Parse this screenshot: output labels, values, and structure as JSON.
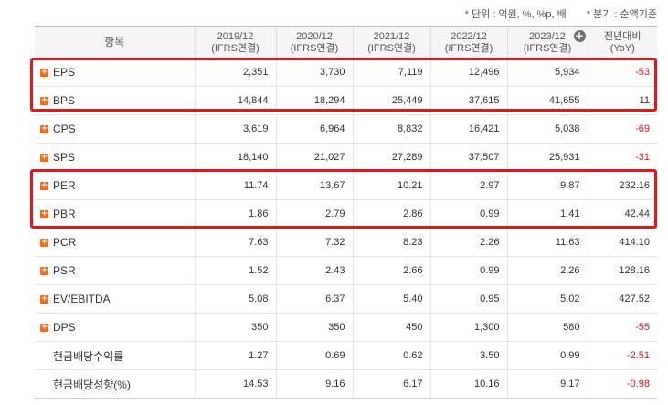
{
  "units_note": "* 단위 : 억원, %, %p, 배",
  "period_note": "* 분기 : 순액기준",
  "header": {
    "item": "항목",
    "cols": [
      {
        "line1": "2019/12",
        "line2": "(IFRS연결)"
      },
      {
        "line1": "2020/12",
        "line2": "(IFRS연결)"
      },
      {
        "line1": "2021/12",
        "line2": "(IFRS연결)"
      },
      {
        "line1": "2022/12",
        "line2": "(IFRS연결)"
      },
      {
        "line1": "2023/12",
        "line2": "(IFRS연결)"
      }
    ],
    "yoy_line1": "전년대비",
    "yoy_line2": "(YoY)"
  },
  "rows": [
    {
      "label": "EPS",
      "values": [
        "2,351",
        "3,730",
        "7,119",
        "12,496",
        "5,934"
      ],
      "yoy": "-53"
    },
    {
      "label": "BPS",
      "values": [
        "14,844",
        "18,294",
        "25,449",
        "37,615",
        "41,655"
      ],
      "yoy": "11"
    },
    {
      "label": "CPS",
      "values": [
        "3,619",
        "6,964",
        "8,832",
        "16,421",
        "5,038"
      ],
      "yoy": "-69"
    },
    {
      "label": "SPS",
      "values": [
        "18,140",
        "21,027",
        "27,289",
        "37,507",
        "25,931"
      ],
      "yoy": "-31"
    },
    {
      "label": "PER",
      "values": [
        "11.74",
        "13.67",
        "10.21",
        "2.97",
        "9.87"
      ],
      "yoy": "232.16"
    },
    {
      "label": "PBR",
      "values": [
        "1.86",
        "2.79",
        "2.86",
        "0.99",
        "1.41"
      ],
      "yoy": "42.44"
    },
    {
      "label": "PCR",
      "values": [
        "7.63",
        "7.32",
        "8.23",
        "2.26",
        "11.63"
      ],
      "yoy": "414.10"
    },
    {
      "label": "PSR",
      "values": [
        "1.52",
        "2.43",
        "2.66",
        "0.99",
        "2.26"
      ],
      "yoy": "128.16"
    },
    {
      "label": "EV/EBITDA",
      "values": [
        "5.08",
        "6.37",
        "5.40",
        "0.95",
        "5.02"
      ],
      "yoy": "427.52"
    },
    {
      "label": "DPS",
      "values": [
        "350",
        "350",
        "450",
        "1,300",
        "580"
      ],
      "yoy": "-55"
    },
    {
      "label": "현금배당수익률",
      "values": [
        "1.27",
        "0.69",
        "0.62",
        "3.50",
        "0.99"
      ],
      "yoy": "-2.51"
    },
    {
      "label": "현금배당성향(%)",
      "values": [
        "14.53",
        "9.16",
        "6.17",
        "10.16",
        "9.17"
      ],
      "yoy": "-0.98"
    }
  ],
  "expandable": [
    true,
    true,
    true,
    true,
    true,
    true,
    true,
    true,
    true,
    true,
    false,
    false
  ],
  "colors": {
    "negative": "#d8171e",
    "highlight": "#e8141a",
    "expand_icon": "#f36b1c"
  }
}
